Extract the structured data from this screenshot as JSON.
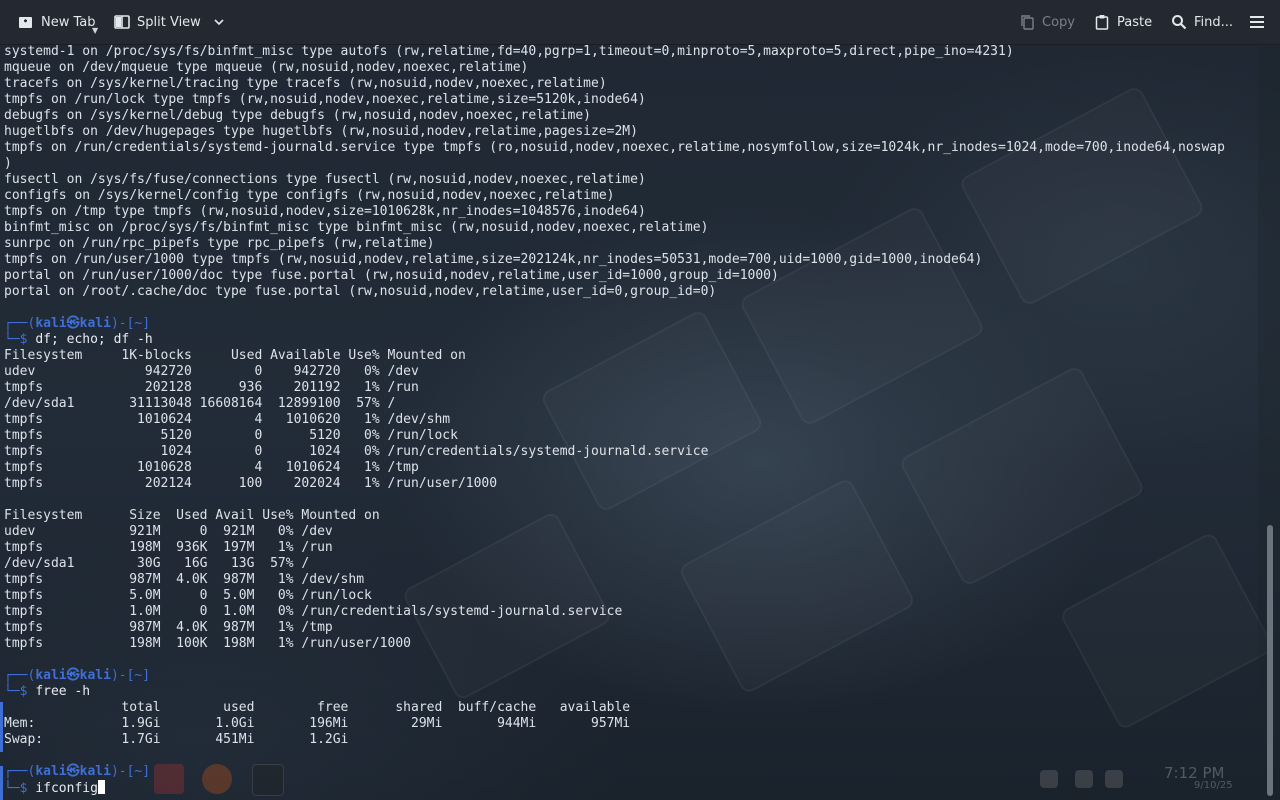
{
  "toolbar": {
    "new_tab": "New Tab",
    "split_view": "Split View",
    "copy": "Copy",
    "paste": "Paste",
    "find": "Find..."
  },
  "terminal": {
    "mount_lines": [
      "systemd-1 on /proc/sys/fs/binfmt_misc type autofs (rw,relatime,fd=40,pgrp=1,timeout=0,minproto=5,maxproto=5,direct,pipe_ino=4231)",
      "mqueue on /dev/mqueue type mqueue (rw,nosuid,nodev,noexec,relatime)",
      "tracefs on /sys/kernel/tracing type tracefs (rw,nosuid,nodev,noexec,relatime)",
      "tmpfs on /run/lock type tmpfs (rw,nosuid,nodev,noexec,relatime,size=5120k,inode64)",
      "debugfs on /sys/kernel/debug type debugfs (rw,nosuid,nodev,noexec,relatime)",
      "hugetlbfs on /dev/hugepages type hugetlbfs (rw,nosuid,nodev,relatime,pagesize=2M)",
      "tmpfs on /run/credentials/systemd-journald.service type tmpfs (ro,nosuid,nodev,noexec,relatime,nosymfollow,size=1024k,nr_inodes=1024,mode=700,inode64,noswap",
      ")",
      "fusectl on /sys/fs/fuse/connections type fusectl (rw,nosuid,nodev,noexec,relatime)",
      "configfs on /sys/kernel/config type configfs (rw,nosuid,nodev,noexec,relatime)",
      "tmpfs on /tmp type tmpfs (rw,nosuid,nodev,size=1010628k,nr_inodes=1048576,inode64)",
      "binfmt_misc on /proc/sys/fs/binfmt_misc type binfmt_misc (rw,nosuid,nodev,noexec,relatime)",
      "sunrpc on /run/rpc_pipefs type rpc_pipefs (rw,relatime)",
      "tmpfs on /run/user/1000 type tmpfs (rw,nosuid,nodev,relatime,size=202124k,nr_inodes=50531,mode=700,uid=1000,gid=1000,inode64)",
      "portal on /run/user/1000/doc type fuse.portal (rw,nosuid,nodev,relatime,user_id=1000,group_id=1000)",
      "portal on /root/.cache/doc type fuse.portal (rw,nosuid,nodev,relatime,user_id=0,group_id=0)"
    ],
    "prompt_top_left": "┌──(",
    "prompt_user": "kali㉿kali",
    "prompt_top_right": ")-[~]",
    "prompt_bottom": "└─$ ",
    "cmd1": "df; echo; df -h",
    "df_lines": [
      "Filesystem     1K-blocks     Used Available Use% Mounted on",
      "udev              942720        0    942720   0% /dev",
      "tmpfs             202128      936    201192   1% /run",
      "/dev/sda1       31113048 16608164  12899100  57% /",
      "tmpfs            1010624        4   1010620   1% /dev/shm",
      "tmpfs               5120        0      5120   0% /run/lock",
      "tmpfs               1024        0      1024   0% /run/credentials/systemd-journald.service",
      "tmpfs            1010628        4   1010624   1% /tmp",
      "tmpfs             202124      100    202024   1% /run/user/1000",
      "",
      "Filesystem      Size  Used Avail Use% Mounted on",
      "udev            921M     0  921M   0% /dev",
      "tmpfs           198M  936K  197M   1% /run",
      "/dev/sda1        30G   16G   13G  57% /",
      "tmpfs           987M  4.0K  987M   1% /dev/shm",
      "tmpfs           5.0M     0  5.0M   0% /run/lock",
      "tmpfs           1.0M     0  1.0M   0% /run/credentials/systemd-journald.service",
      "tmpfs           987M  4.0K  987M   1% /tmp",
      "tmpfs           198M  100K  198M   1% /run/user/1000"
    ],
    "cmd2": "free -h",
    "free_lines": [
      "               total        used        free      shared  buff/cache   available",
      "Mem:           1.9Gi       1.0Gi       196Mi        29Mi       944Mi       957Mi",
      "Swap:          1.7Gi       451Mi       1.2Gi"
    ],
    "cmd3": "ifconfig"
  },
  "clock": {
    "time": "7:12 PM",
    "date": "9/10/25"
  }
}
